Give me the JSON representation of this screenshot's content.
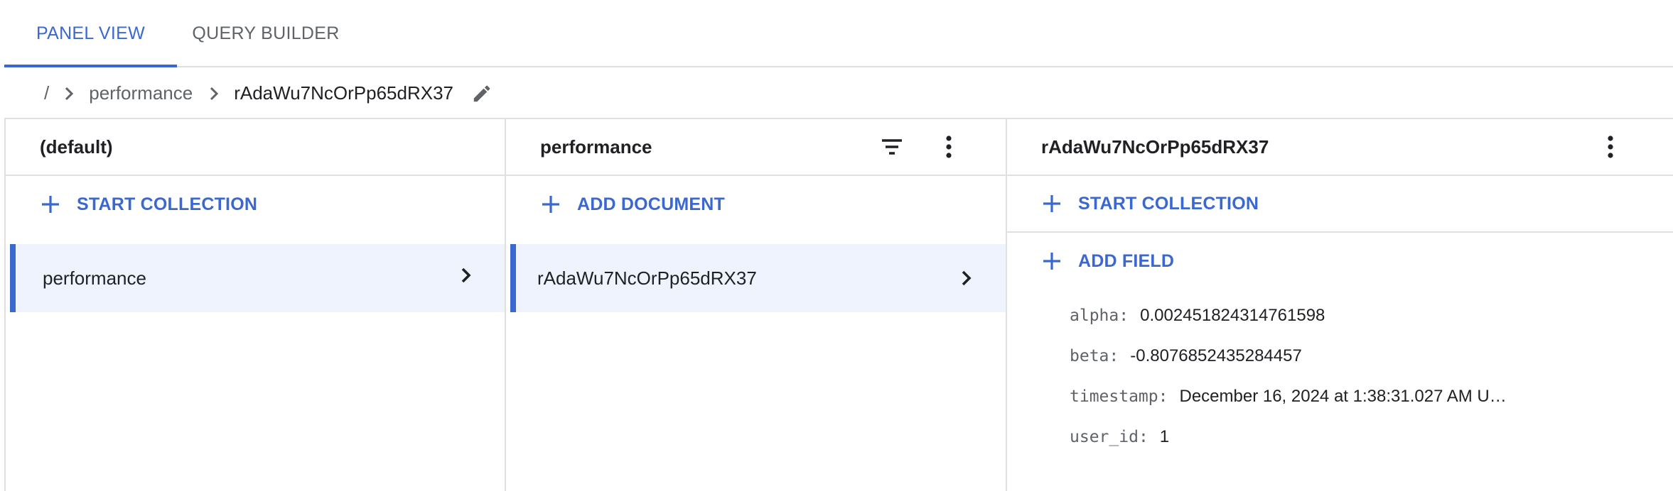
{
  "tabs": [
    {
      "label": "PANEL VIEW",
      "active": true
    },
    {
      "label": "QUERY BUILDER",
      "active": false
    }
  ],
  "breadcrumb": {
    "root": "/",
    "collection": "performance",
    "document": "rAdaWu7NcOrPp65dRX37",
    "edit_icon": "pencil-icon"
  },
  "panels": {
    "root": {
      "title": "(default)",
      "action_label": "START COLLECTION",
      "items": [
        {
          "label": "performance",
          "selected": true
        }
      ]
    },
    "collection": {
      "title": "performance",
      "filter_icon": "filter-icon",
      "menu_icon": "more-vert-icon",
      "action_label": "ADD DOCUMENT",
      "items": [
        {
          "label": "rAdaWu7NcOrPp65dRX37",
          "selected": true
        }
      ]
    },
    "document": {
      "title": "rAdaWu7NcOrPp65dRX37",
      "menu_icon": "more-vert-icon",
      "collection_action_label": "START COLLECTION",
      "field_action_label": "ADD FIELD",
      "fields": [
        {
          "key": "alpha",
          "sep": ":",
          "value": "0.002451824314761598"
        },
        {
          "key": "beta",
          "sep": ":",
          "value": "-0.8076852435284457"
        },
        {
          "key": "timestamp",
          "sep": ":",
          "value": "December 16, 2024 at 1:38:31.027 AM U…"
        },
        {
          "key": "user_id",
          "sep": ":",
          "value": "1"
        }
      ]
    }
  },
  "colors": {
    "accent": "#3b68d0",
    "selected_bg": "#eef3fd",
    "divider": "#e0e0e0"
  }
}
